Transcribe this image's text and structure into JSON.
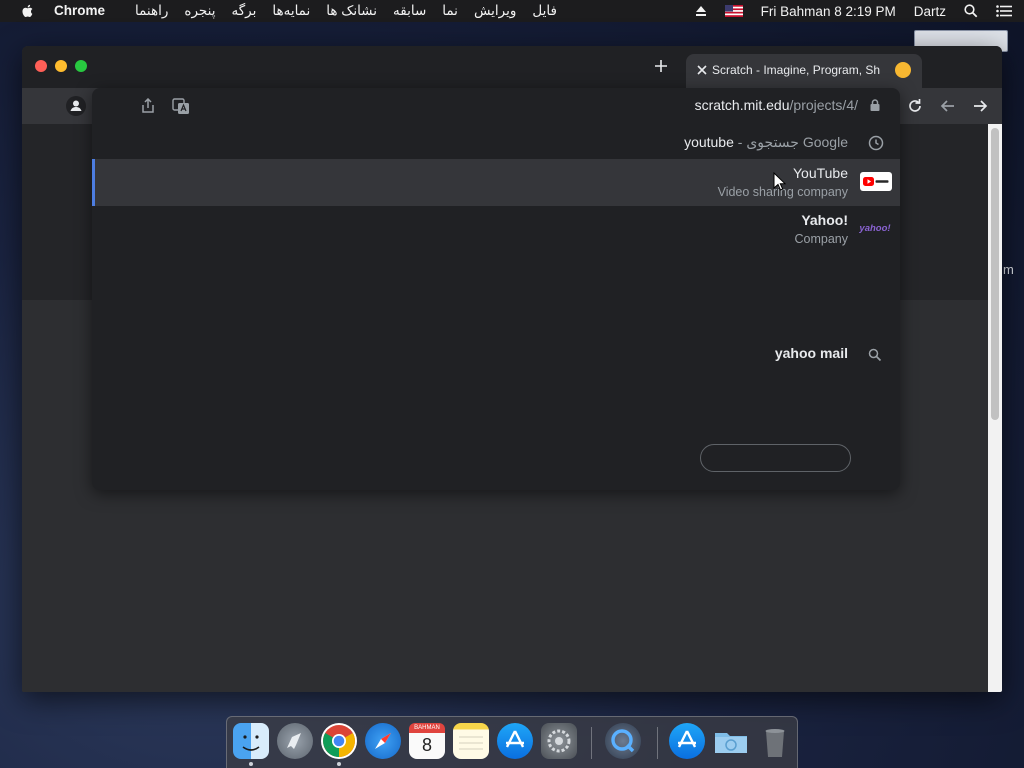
{
  "menubar": {
    "app_name": "Chrome",
    "menus": [
      "فایل",
      "ویرایش",
      "نما",
      "سابقه",
      "نشانک ها",
      "نمایه‌ها",
      "برگه",
      "پنجره",
      "راهنما"
    ],
    "clock": "Fri Bahman 8  2:19 PM",
    "user": "Dartz"
  },
  "tab": {
    "title": "Scratch - Imagine, Program, Sh"
  },
  "omnibox": {
    "url_host": "scratch.mit.edu",
    "url_path": "/projects/4/",
    "history_suggestion": {
      "query": "youtube",
      "suffix": " - جستجوی Google"
    },
    "suggestions": [
      {
        "title": "YouTube",
        "subtitle": "Video sharing company",
        "icon": "youtube-logo-icon"
      },
      {
        "title": "Yahoo!",
        "subtitle": "Company",
        "icon": "yahoo-logo-icon",
        "logo_text": "yahoo!"
      }
    ],
    "search_suggestion": "yahoo mail"
  },
  "dock": {
    "calendar_month": "BAHMAN",
    "calendar_day": "8"
  },
  "desktop": {
    "fragment": "m"
  },
  "colors": {
    "accent": "#4d7de0",
    "omnibox_bg": "#202124",
    "toolbar_bg": "#35363a",
    "selected_row": "#35363a"
  }
}
